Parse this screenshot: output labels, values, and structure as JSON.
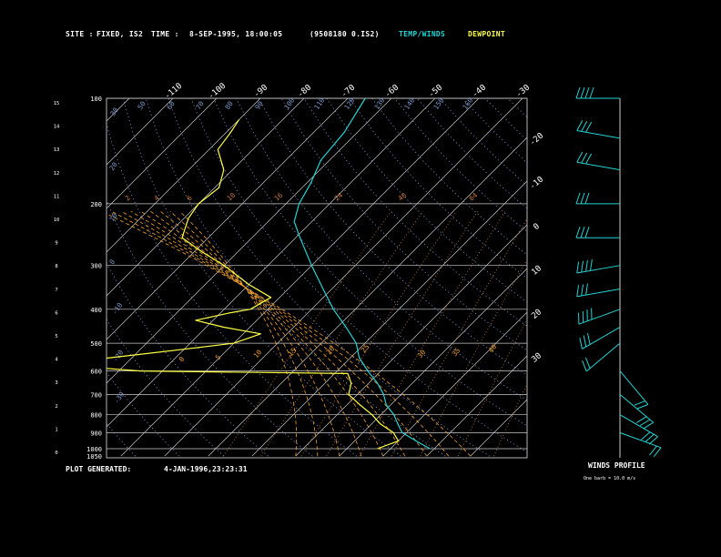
{
  "header": {
    "site_label": "SITE :",
    "site_value": "FIXED, IS2",
    "time_label": "TIME :",
    "time_value": "8-SEP-1995, 18:00:05",
    "file_id": "(9508180 0.IS2)",
    "temp_winds_legend": "TEMP/WINDS",
    "dewpoint_legend": "DEWPOINT"
  },
  "footer": {
    "plot_generated_label": "PLOT GENERATED:",
    "plot_generated_value": "4-JAN-1996,23:23:31"
  },
  "wind_panel": {
    "title": "WINDS PROFILE",
    "note": "One barb = 10.0 m/s"
  },
  "colors": {
    "background": "#000000",
    "temperature": "#22d3d3",
    "dewpoint": "#ffff44",
    "isotherm": "#c8c8c8",
    "mixing_ratio": "#c8783c",
    "dry_adiabat": "#7a96c8",
    "wet_adiabat": "#f0a030",
    "wind": "#22d3d3"
  },
  "chart_data": {
    "type": "line",
    "kind": "Skew-T log-P sounding",
    "pressure_ticks": [
      "100",
      "200",
      "300",
      "400",
      "500",
      "600",
      "700",
      "800",
      "900",
      "1000",
      "1050"
    ],
    "pressure_levels": [
      100,
      200,
      300,
      400,
      500,
      600,
      700,
      800,
      900,
      1000
    ],
    "pressure_range": [
      100,
      1050
    ],
    "height_ticks": [
      "0",
      "1",
      "2",
      "3",
      "4",
      "5",
      "6",
      "7",
      "8",
      "9",
      "10",
      "11",
      "12",
      "13",
      "14",
      "15"
    ],
    "temperature_ticks": [
      "-110",
      "-100",
      "-90",
      "-80",
      "-70",
      "-60",
      "-50",
      "-40",
      "-30",
      "-20",
      "-10",
      "0",
      "10",
      "20",
      "30"
    ],
    "isotherm_range": [
      -140,
      40
    ],
    "dry_adiabat_labels": [
      "30",
      "50",
      "60",
      "70",
      "80",
      "90",
      "100",
      "110",
      "120",
      "130",
      "140",
      "150",
      "160",
      "20",
      "10",
      "0",
      "-10",
      "-20",
      "-30"
    ],
    "mixing_ratio_labels": [
      "2",
      "4",
      "6",
      "10",
      "16",
      "24",
      "40",
      "64"
    ],
    "wet_adiabat_labels": [
      "0",
      "5",
      "10",
      "15",
      "20",
      "25",
      "30",
      "35",
      "40"
    ],
    "series": [
      {
        "name": "TEMP/WINDS",
        "points": [
          [
            1000,
            29
          ],
          [
            950,
            24
          ],
          [
            900,
            19
          ],
          [
            850,
            16
          ],
          [
            800,
            13
          ],
          [
            750,
            9
          ],
          [
            700,
            6
          ],
          [
            650,
            2
          ],
          [
            600,
            -3
          ],
          [
            550,
            -8
          ],
          [
            500,
            -12
          ],
          [
            450,
            -18
          ],
          [
            400,
            -25
          ],
          [
            350,
            -32
          ],
          [
            300,
            -40
          ],
          [
            250,
            -49
          ],
          [
            225,
            -54
          ],
          [
            200,
            -57
          ],
          [
            175,
            -59
          ],
          [
            150,
            -62
          ],
          [
            125,
            -63
          ],
          [
            100,
            -66
          ]
        ]
      },
      {
        "name": "DEWPOINT",
        "points": [
          [
            1000,
            17
          ],
          [
            950,
            20
          ],
          [
            900,
            17
          ],
          [
            850,
            12
          ],
          [
            800,
            8
          ],
          [
            750,
            3
          ],
          [
            700,
            -2
          ],
          [
            650,
            -4
          ],
          [
            610,
            -7
          ],
          [
            600,
            -55
          ],
          [
            580,
            -72
          ],
          [
            560,
            -70
          ],
          [
            540,
            -60
          ],
          [
            520,
            -50
          ],
          [
            500,
            -40
          ],
          [
            470,
            -36
          ],
          [
            450,
            -46
          ],
          [
            430,
            -54
          ],
          [
            410,
            -48
          ],
          [
            400,
            -44
          ],
          [
            370,
            -42
          ],
          [
            340,
            -50
          ],
          [
            300,
            -60
          ],
          [
            275,
            -68
          ],
          [
            250,
            -76
          ],
          [
            220,
            -79
          ],
          [
            200,
            -80
          ],
          [
            180,
            -79
          ],
          [
            160,
            -82
          ],
          [
            140,
            -88
          ],
          [
            125,
            -89
          ],
          [
            115,
            -90
          ]
        ]
      }
    ],
    "wind_barbs": [
      {
        "p": 100,
        "dir": 270,
        "speed": 35
      },
      {
        "p": 130,
        "dir": 280,
        "speed": 30
      },
      {
        "p": 160,
        "dir": 280,
        "speed": 30
      },
      {
        "p": 200,
        "dir": 270,
        "speed": 25
      },
      {
        "p": 250,
        "dir": 270,
        "speed": 25
      },
      {
        "p": 300,
        "dir": 260,
        "speed": 35
      },
      {
        "p": 350,
        "dir": 260,
        "speed": 30
      },
      {
        "p": 400,
        "dir": 250,
        "speed": 35
      },
      {
        "p": 450,
        "dir": 240,
        "speed": 30
      },
      {
        "p": 500,
        "dir": 230,
        "speed": 20
      },
      {
        "p": 600,
        "dir": 140,
        "speed": 20
      },
      {
        "p": 700,
        "dir": 130,
        "speed": 30
      },
      {
        "p": 800,
        "dir": 120,
        "speed": 30
      },
      {
        "p": 900,
        "dir": 110,
        "speed": 20
      }
    ]
  }
}
